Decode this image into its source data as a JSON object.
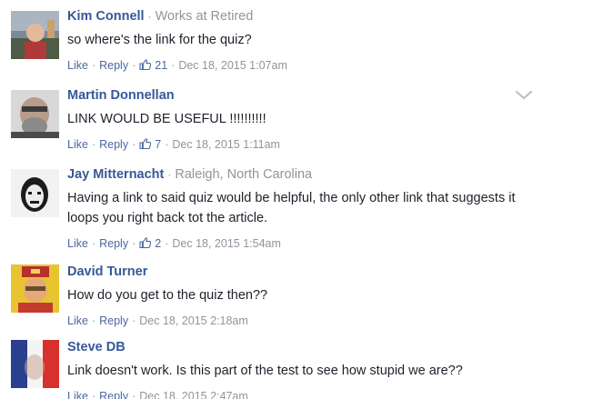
{
  "comments": [
    {
      "author": "Kim Connell",
      "meta": "Works at Retired",
      "text": "so where's the link for the quiz?",
      "like_label": "Like",
      "reply_label": "Reply",
      "like_count": "21",
      "timestamp": "Dec 18, 2015 1:07am"
    },
    {
      "author": "Martin Donnellan",
      "meta": "",
      "text": "LINK WOULD BE USEFUL !!!!!!!!!!",
      "like_label": "Like",
      "reply_label": "Reply",
      "like_count": "7",
      "timestamp": "Dec 18, 2015 1:11am"
    },
    {
      "author": "Jay Mitternacht",
      "meta": "Raleigh, North Carolina",
      "text": "Having a link to said quiz would be helpful, the only other link that suggests it loops you right back tot the article.",
      "like_label": "Like",
      "reply_label": "Reply",
      "like_count": "2",
      "timestamp": "Dec 18, 2015 1:54am"
    },
    {
      "author": "David Turner",
      "meta": "",
      "text": "How do you get to the quiz then??",
      "like_label": "Like",
      "reply_label": "Reply",
      "like_count": "",
      "timestamp": "Dec 18, 2015 2:18am"
    },
    {
      "author": "Steve DB",
      "meta": "",
      "text": "Link doesn't work. Is this part of the test to see how stupid we are??",
      "like_label": "Like",
      "reply_label": "Reply",
      "like_count": "",
      "timestamp": "Dec 18, 2015 2:47am"
    }
  ],
  "icons": {
    "like": "thumbs-up-icon",
    "menu": "chevron-down-icon"
  },
  "colors": {
    "author": "#365899",
    "link": "#4b67a1",
    "meta": "#90949c",
    "text": "#1d2129"
  }
}
